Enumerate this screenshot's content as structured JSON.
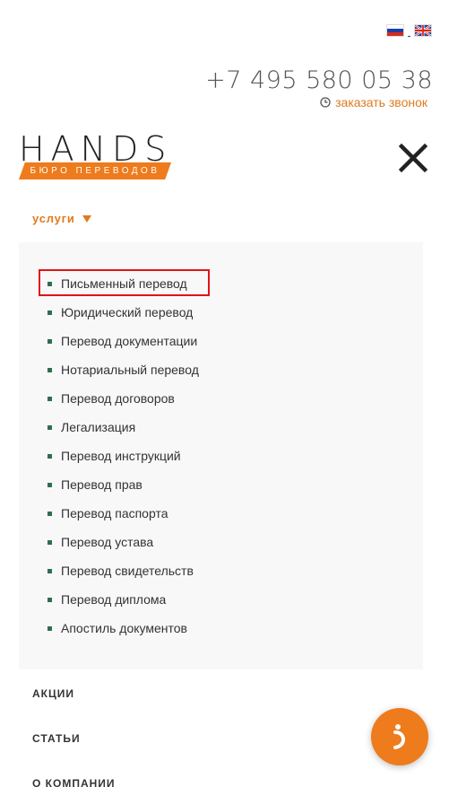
{
  "header": {
    "languages": [
      {
        "code": "ru",
        "icon": "russia-flag-icon"
      },
      {
        "code": "en",
        "icon": "uk-flag-icon"
      }
    ],
    "phone": "+7 495 580 05 38",
    "callback": {
      "label": "заказать звонок",
      "icon": "clock-icon"
    }
  },
  "logo": {
    "word": "HANDS",
    "tagline": "БЮРО ПЕРЕВОДОВ"
  },
  "menu": {
    "close_icon": "close-icon",
    "services": {
      "label": "услуги",
      "icon": "triangle-down-icon"
    },
    "services_items": [
      "Письменный перевод",
      "Юридический перевод",
      "Перевод документации",
      "Нотариальный перевод",
      "Перевод договоров",
      "Легализация",
      "Перевод инструкций",
      "Перевод прав",
      "Перевод паспорта",
      "Перевод устава",
      "Перевод свидетельств",
      "Перевод диплома",
      "Апостиль документов"
    ],
    "other_items": [
      "акции",
      "статьи",
      "о компании"
    ]
  },
  "chat_button": {
    "icon": "chat-icon"
  },
  "colors": {
    "accent": "#ee7b1c",
    "bullet": "#2e6f4e",
    "highlight": "#e0141a",
    "submenu_bg": "#f8f8f8"
  }
}
